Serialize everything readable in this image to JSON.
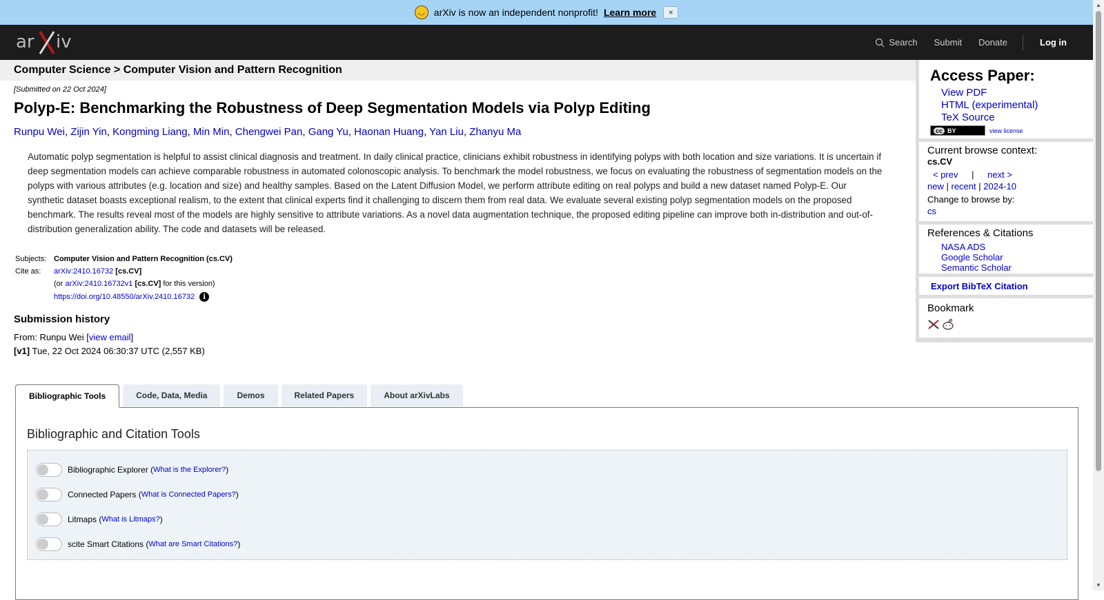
{
  "banner": {
    "text": "arXiv is now an independent nonprofit!",
    "link": "Learn more",
    "close": "×"
  },
  "header": {
    "logo_text": "arXiv",
    "nav": {
      "search": "Search",
      "submit": "Submit",
      "donate": "Donate",
      "login": "Log in"
    }
  },
  "breadcrumb": "Computer Science > Computer Vision and Pattern Recognition",
  "paper": {
    "submitted": "[Submitted on 22 Oct 2024]",
    "title": "Polyp-E: Benchmarking the Robustness of Deep Segmentation Models via Polyp Editing",
    "authors": [
      "Runpu Wei",
      "Zijin Yin",
      "Kongming Liang",
      "Min Min",
      "Chengwei Pan",
      "Gang Yu",
      "Haonan Huang",
      "Yan Liu",
      "Zhanyu Ma"
    ],
    "abstract": "Automatic polyp segmentation is helpful to assist clinical diagnosis and treatment. In daily clinical practice, clinicians exhibit robustness in identifying polyps with both location and size variations. It is uncertain if deep segmentation models can achieve comparable robustness in automated colonoscopic analysis. To benchmark the model robustness, we focus on evaluating the robustness of segmentation models on the polyps with various attributes (e.g. location and size) and healthy samples. Based on the Latent Diffusion Model, we perform attribute editing on real polyps and build a new dataset named Polyp-E. Our synthetic dataset boasts exceptional realism, to the extent that clinical experts find it challenging to discern them from real data. We evaluate several existing polyp segmentation models on the proposed benchmark. The results reveal most of the models are highly sensitive to attribute variations. As a novel data augmentation technique, the proposed editing pipeline can improve both in-distribution and out-of-distribution generalization ability. The code and datasets will be released.",
    "subjects_label": "Subjects:",
    "subjects": "Computer Vision and Pattern Recognition (cs.CV)",
    "cite_label": "Cite as:",
    "cite_id": "arXiv:2410.16732",
    "cite_cat": "[cs.CV]",
    "cite_or": "(or",
    "cite_v1": "arXiv:2410.16732v1",
    "cite_v1_cat": "[cs.CV]",
    "cite_v1_suffix": "for this version)",
    "doi": "https://doi.org/10.48550/arXiv.2410.16732",
    "history_title": "Submission history",
    "from_prefix": "From: Runpu Wei [",
    "view_email": "view email",
    "from_suffix": "]",
    "v1_label": "[v1]",
    "v1_text": "Tue, 22 Oct 2024 06:30:37 UTC (2,557 KB)"
  },
  "sidebar": {
    "access_title": "Access Paper:",
    "access_links": [
      "View PDF",
      "HTML (experimental)",
      "TeX Source"
    ],
    "cc_badge": "BY",
    "view_license": "view license",
    "context_title": "Current browse context:",
    "context": "cs.CV",
    "prev": "< prev",
    "pipe": "|",
    "next": "next >",
    "new": "new",
    "recent": "recent",
    "month": "2024-10",
    "change_to": "Change to browse by:",
    "cs": "cs",
    "refs_title": "References & Citations",
    "refs": [
      "NASA ADS",
      "Google Scholar",
      "Semantic Scholar"
    ],
    "export": "Export BibTeX Citation",
    "bookmark": "Bookmark"
  },
  "tabs": [
    "Bibliographic Tools",
    "Code, Data, Media",
    "Demos",
    "Related Papers",
    "About arXivLabs"
  ],
  "panel": {
    "title": "Bibliographic and Citation Tools",
    "tools": [
      {
        "name": "Bibliographic Explorer",
        "link": "What is the Explorer?"
      },
      {
        "name": "Connected Papers",
        "link": "What is Connected Papers?"
      },
      {
        "name": "Litmaps",
        "link": "What is Litmaps?"
      },
      {
        "name": "scite Smart Citations",
        "link": "What are Smart Citations?"
      }
    ]
  }
}
